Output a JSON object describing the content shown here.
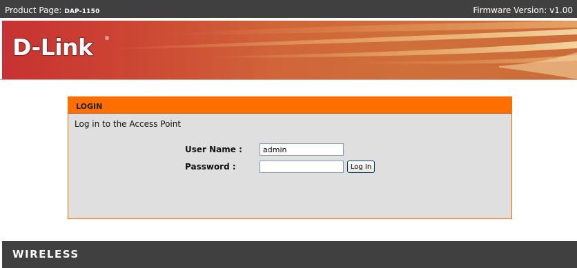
{
  "topbar": {
    "product_label": "Product Page:",
    "model": "DAP-1150",
    "firmware": "Firmware Version: v1.00"
  },
  "banner": {
    "logo_text": "D-Link",
    "registered_mark": "®"
  },
  "login": {
    "header": "LOGIN",
    "subtitle": "Log in to the Access Point",
    "username_label": "User Name :",
    "username_value": "admin",
    "password_label": "Password :",
    "password_value": "",
    "login_button": "Log In"
  },
  "footer": {
    "text": "WIRELESS"
  },
  "colors": {
    "bar": "#404040",
    "accent_orange": "#ff6f00",
    "panel_bg": "#dfdfdf",
    "banner_red": "#c73232",
    "banner_orange": "#cf6f3a"
  }
}
